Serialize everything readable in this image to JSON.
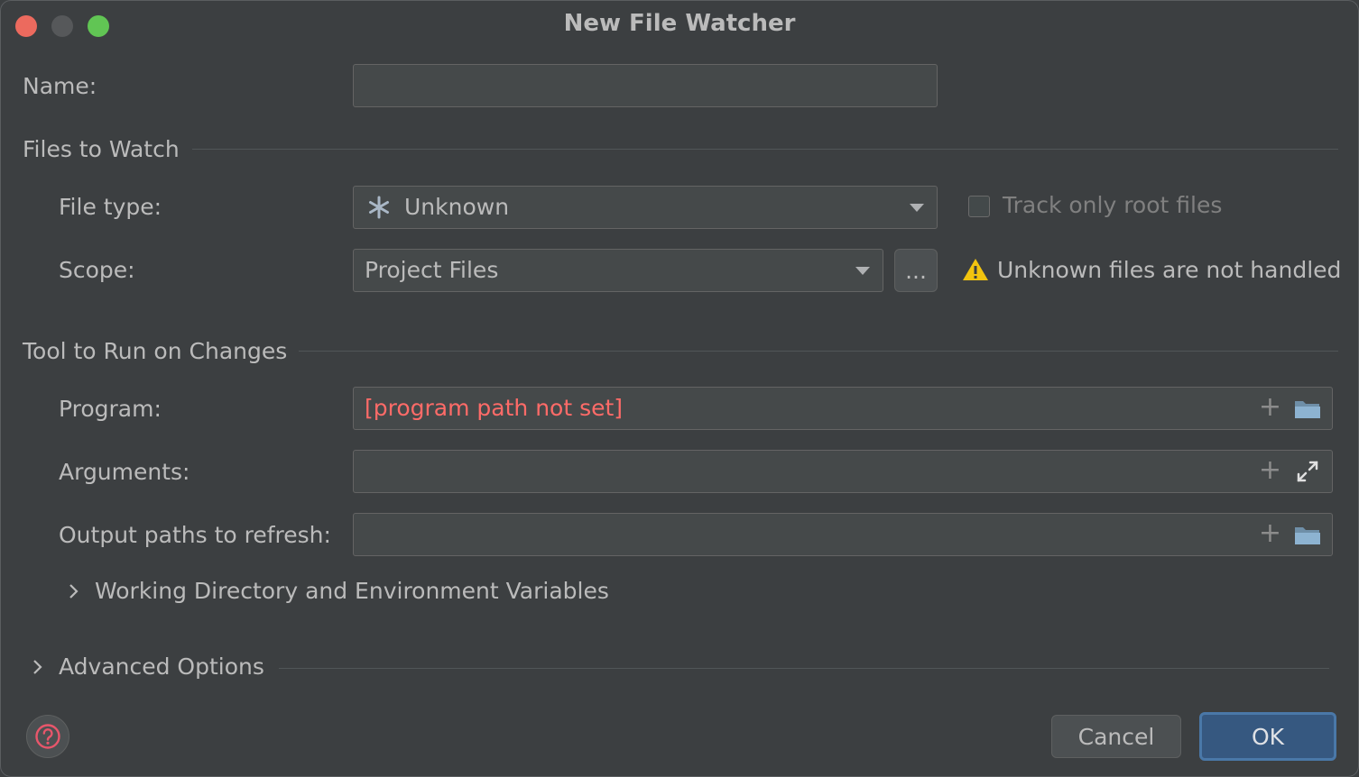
{
  "window": {
    "title": "New File Watcher"
  },
  "name": {
    "label": "Name:",
    "value": ""
  },
  "files_to_watch": {
    "heading": "Files to Watch",
    "file_type_label": "File type:",
    "file_type_value": "Unknown",
    "track_root_label": "Track only root files",
    "scope_label": "Scope:",
    "scope_value": "Project Files",
    "scope_more": "...",
    "warning_text": "Unknown files are not handled"
  },
  "tool": {
    "heading": "Tool to Run on Changes",
    "program_label": "Program:",
    "program_value": "[program path not set]",
    "arguments_label": "Arguments:",
    "arguments_value": "",
    "output_label": "Output paths to refresh:",
    "output_value": "",
    "working_dir_label": "Working Directory and Environment Variables"
  },
  "advanced": {
    "label": "Advanced Options"
  },
  "buttons": {
    "cancel": "Cancel",
    "ok": "OK",
    "help": "?"
  },
  "icons": {
    "file_type": "asterisk-icon",
    "warning": "warning-icon",
    "folder": "folder-icon",
    "expand": "expand-icon",
    "chevron": "chevron-right-icon"
  },
  "colors": {
    "error": "#ff6b68",
    "ok_button": "#365880",
    "warning": "#f2c40f"
  }
}
